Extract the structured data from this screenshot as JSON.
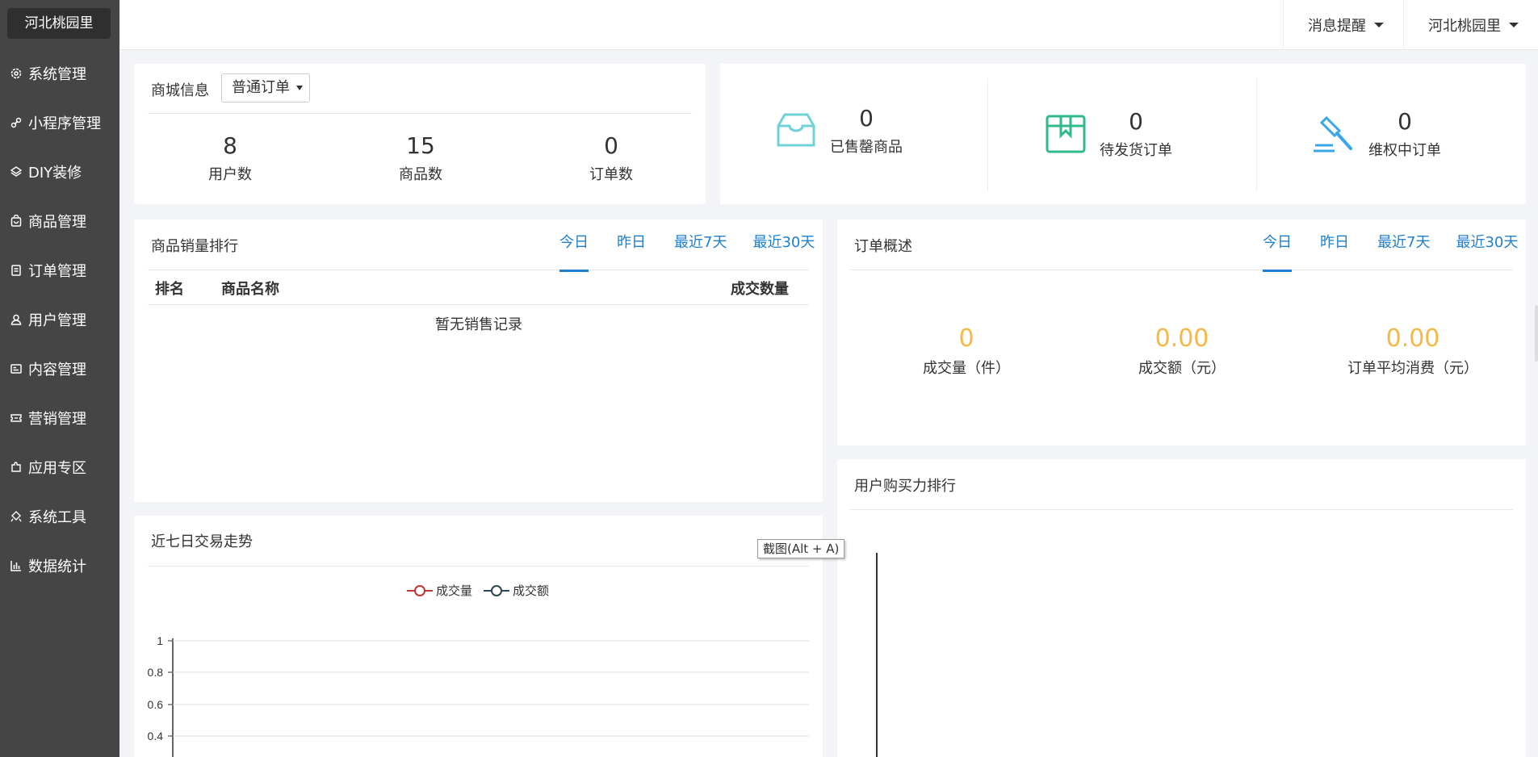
{
  "sidebar": {
    "brand": "河北桃园里",
    "items": [
      {
        "label": "系统管理",
        "icon": "gear-icon"
      },
      {
        "label": "小程序管理",
        "icon": "link-icon"
      },
      {
        "label": "DIY装修",
        "icon": "layers-icon"
      },
      {
        "label": "商品管理",
        "icon": "bag-icon"
      },
      {
        "label": "订单管理",
        "icon": "order-icon"
      },
      {
        "label": "用户管理",
        "icon": "user-icon"
      },
      {
        "label": "内容管理",
        "icon": "content-icon"
      },
      {
        "label": "营销管理",
        "icon": "ticket-icon"
      },
      {
        "label": "应用专区",
        "icon": "puzzle-icon"
      },
      {
        "label": "系统工具",
        "icon": "tool-icon"
      },
      {
        "label": "数据统计",
        "icon": "bar-chart-icon"
      }
    ]
  },
  "header": {
    "notifications": "消息提醒",
    "account": "河北桃园里"
  },
  "shop_info": {
    "title": "商城信息",
    "select_value": "普通订单",
    "stats": [
      {
        "value": "8",
        "label": "用户数"
      },
      {
        "value": "15",
        "label": "商品数"
      },
      {
        "value": "0",
        "label": "订单数"
      }
    ]
  },
  "kpis": [
    {
      "value": "0",
      "label": "已售罄商品",
      "icon": "inbox-icon",
      "color": "#6fd3d6"
    },
    {
      "value": "0",
      "label": "待发货订单",
      "icon": "package-icon",
      "color": "#2fba8c"
    },
    {
      "value": "0",
      "label": "维权中订单",
      "icon": "gavel-icon",
      "color": "#3aa6e8"
    }
  ],
  "sales_rank": {
    "title": "商品销量排行",
    "tabs": [
      "今日",
      "昨日",
      "最近7天",
      "最近30天"
    ],
    "columns": [
      "排名",
      "商品名称",
      "成交数量"
    ],
    "empty": "暂无销售记录"
  },
  "order_overview": {
    "title": "订单概述",
    "tabs": [
      "今日",
      "昨日",
      "最近7天",
      "最近30天"
    ],
    "items": [
      {
        "value": "0",
        "label": "成交量（件）"
      },
      {
        "value": "0.00",
        "label": "成交额（元）"
      },
      {
        "value": "0.00",
        "label": "订单平均消费（元）"
      }
    ]
  },
  "trend": {
    "title": "近七日交易走势",
    "legend": [
      {
        "name": "成交量",
        "color": "#c23531"
      },
      {
        "name": "成交额",
        "color": "#2f4554"
      }
    ],
    "yticks": [
      "1",
      "0.8",
      "0.6",
      "0.4"
    ]
  },
  "buy_rank": {
    "title": "用户购买力排行"
  },
  "tooltip": "截图(Alt + A)"
}
